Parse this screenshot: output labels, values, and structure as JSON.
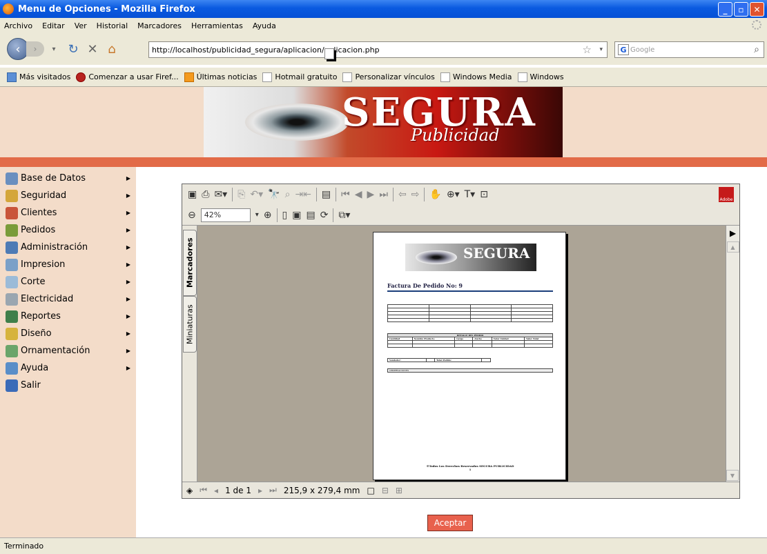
{
  "window": {
    "title": "Menu de Opciones - Mozilla Firefox"
  },
  "menubar": [
    "Archivo",
    "Editar",
    "Ver",
    "Historial",
    "Marcadores",
    "Herramientas",
    "Ayuda"
  ],
  "nav": {
    "url": "http://localhost/publicidad_segura/aplicacion/aplicacion.php",
    "search_placeholder": "Google"
  },
  "bookmarks": [
    "Más visitados",
    "Comenzar a usar Firef...",
    "Últimas noticias",
    "Hotmail gratuito",
    "Personalizar vínculos",
    "Windows Media",
    "Windows"
  ],
  "banner": {
    "title": "SEGURA",
    "subtitle": "Publicidad"
  },
  "sidebar": {
    "items": [
      {
        "label": "Base de Datos",
        "icon": "database-icon",
        "color": "#6a8fbf"
      },
      {
        "label": "Seguridad",
        "icon": "key-icon",
        "color": "#d4a63a"
      },
      {
        "label": "Clientes",
        "icon": "users-icon",
        "color": "#c9553a"
      },
      {
        "label": "Pedidos",
        "icon": "pencil-icon",
        "color": "#7a9c3a"
      },
      {
        "label": "Administración",
        "icon": "admin-icon",
        "color": "#4e7bb5"
      },
      {
        "label": "Impresion",
        "icon": "printer-icon",
        "color": "#7aa0c8"
      },
      {
        "label": "Corte",
        "icon": "scissors-icon",
        "color": "#9bbbd8"
      },
      {
        "label": "Electricidad",
        "icon": "bolt-icon",
        "color": "#9aa6b0"
      },
      {
        "label": "Reportes",
        "icon": "report-icon",
        "color": "#3f7f4a"
      },
      {
        "label": "Diseño",
        "icon": "design-icon",
        "color": "#d6b33d"
      },
      {
        "label": "Ornamentación",
        "icon": "ornament-icon",
        "color": "#6aa56a"
      },
      {
        "label": "Ayuda",
        "icon": "help-icon",
        "color": "#5a8ec8"
      },
      {
        "label": "Salir",
        "icon": "exit-icon",
        "color": "#3b6bb8"
      }
    ]
  },
  "viewer": {
    "zoom": "42%",
    "tab_bookmarks": "Marcadores",
    "tab_thumbnails": "Miniaturas",
    "page_indicator": "1 de 1",
    "page_size": "215,9 x 279,4 mm"
  },
  "document": {
    "banner_title": "SEGURA",
    "title": "Factura De Pedido No: 9",
    "detail_header": "DETALLE DEL PEDIDO",
    "columns": [
      "Cantidad",
      "Nombre Producto",
      "Largo",
      "Ancho",
      "Valor Unidad",
      "Valor Total"
    ],
    "vendedor_label": "Vendedor:",
    "total_label": "Total Pedido:",
    "observaciones": "OBSERVACIONES",
    "footer": "©Todos Los Derechos Reservados SEGURA PUBLICIDAD",
    "page_number": "1"
  },
  "action": {
    "accept_label": "Aceptar"
  },
  "status": {
    "text": "Terminado"
  }
}
